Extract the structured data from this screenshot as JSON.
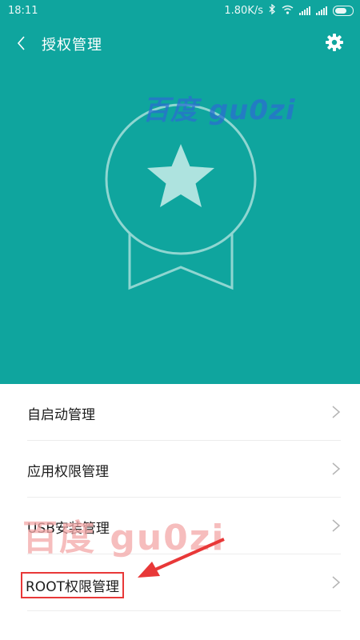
{
  "status_bar": {
    "time": "18:11",
    "network_speed": "1.80K/s"
  },
  "header": {
    "title": "授权管理",
    "back_icon": "chevron-left-icon",
    "settings_icon": "gear-icon"
  },
  "hero": {
    "background_color": "#0fa59e",
    "badge_icon": "star-medal-icon"
  },
  "list": {
    "items": [
      {
        "label": "自启动管理"
      },
      {
        "label": "应用权限管理"
      },
      {
        "label": "USB安装管理"
      },
      {
        "label": "ROOT权限管理"
      }
    ]
  },
  "annotation": {
    "highlight_color": "#e83838",
    "watermark_top": "百度 gu0zi",
    "watermark_bottom": "百度  gu0zi"
  }
}
